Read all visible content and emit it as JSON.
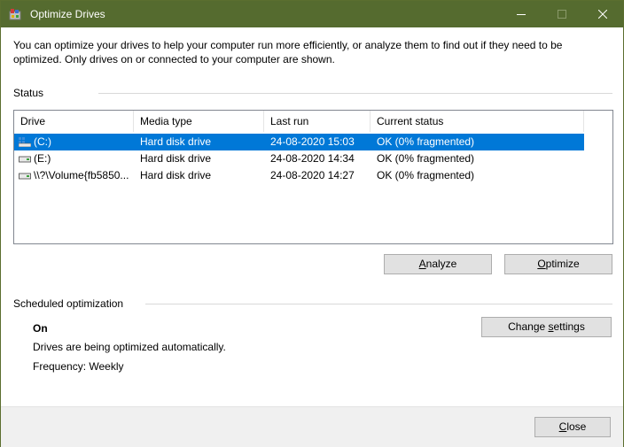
{
  "window": {
    "title": "Optimize Drives"
  },
  "intro_text": "You can optimize your drives to help your computer run more efficiently, or analyze them to find out if they need to be optimized. Only drives on or connected to your computer are shown.",
  "status": {
    "label": "Status",
    "columns": [
      "Drive",
      "Media type",
      "Last run",
      "Current status"
    ],
    "rows": [
      {
        "drive": "(C:)",
        "media": "Hard disk drive",
        "last_run": "24-08-2020 15:03",
        "status": "OK (0% fragmented)",
        "icon": "system-drive-icon"
      },
      {
        "drive": "(E:)",
        "media": "Hard disk drive",
        "last_run": "24-08-2020 14:34",
        "status": "OK (0% fragmented)",
        "icon": "drive-icon"
      },
      {
        "drive": "\\\\?\\Volume{fb5850...",
        "media": "Hard disk drive",
        "last_run": "24-08-2020 14:27",
        "status": "OK (0% fragmented)",
        "icon": "drive-icon"
      }
    ],
    "analyze_label_prefix": "",
    "analyze_label_mnemonic": "A",
    "analyze_label_rest": "nalyze",
    "optimize_label_prefix": "",
    "optimize_label_mnemonic": "O",
    "optimize_label_rest": "ptimize"
  },
  "schedule": {
    "label": "Scheduled optimization",
    "state": "On",
    "description": "Drives are being optimized automatically.",
    "frequency": "Frequency: Weekly",
    "change_label_prefix": "Change ",
    "change_label_mnemonic": "s",
    "change_label_rest": "ettings"
  },
  "footer": {
    "close_label_mnemonic": "C",
    "close_label_rest": "lose"
  },
  "colors": {
    "titlebar": "#556b2f",
    "selection": "#0078d7"
  }
}
